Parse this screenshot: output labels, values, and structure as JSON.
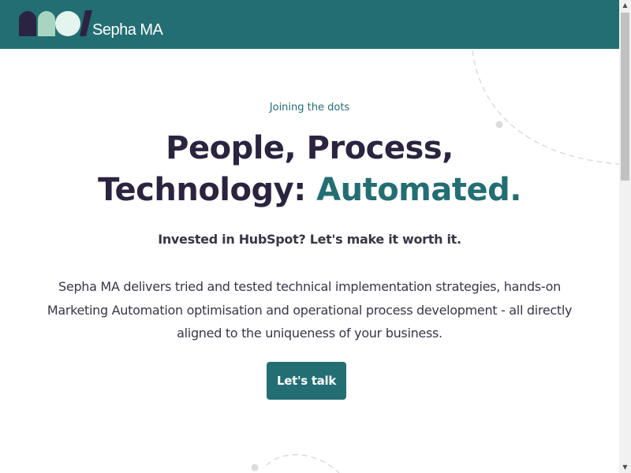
{
  "header": {
    "brand": "Sepha MA"
  },
  "hero": {
    "eyebrow": "Joining the dots",
    "headline_line1": "People, Process,",
    "headline_line2_prefix": "Technology: ",
    "headline_line2_accent": "Automated.",
    "subheadline": "Invested in HubSpot? Let's make it worth it.",
    "description": "Sepha MA delivers tried and tested technical implementation strategies, hands-on Marketing Automation optimisation and operational process development - all directly aligned to the uniqueness of your business.",
    "cta_label": "Let's talk"
  },
  "scrollbar": {
    "up_arrow": "▲",
    "down_arrow": "▼"
  },
  "icons": {
    "logo": "sepha-ma-logo-mark",
    "scroll_up": "triangle-up",
    "scroll_down": "triangle-down"
  },
  "colors": {
    "primary_teal": "#236e73",
    "heading_dark": "#2b2440",
    "logo_dark": "#2b2440",
    "logo_mint": "#a8d5c1",
    "logo_pale": "#e3f5ee",
    "text_body": "#3a3547",
    "decoration_gray": "#dcdcdc"
  }
}
